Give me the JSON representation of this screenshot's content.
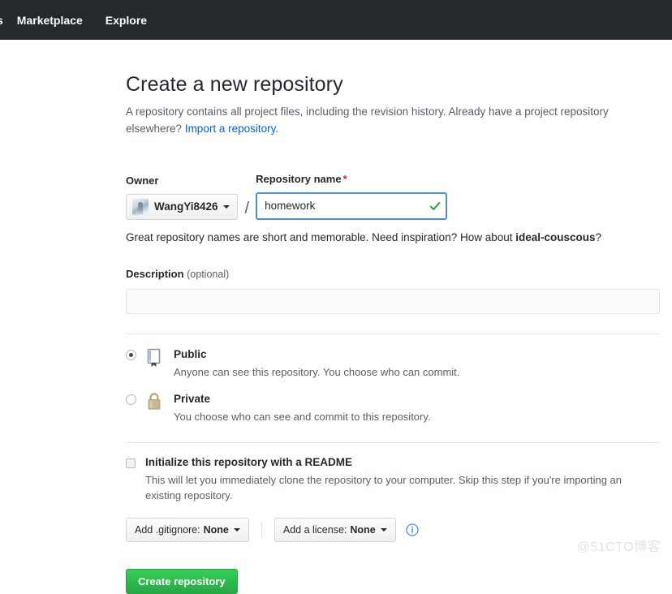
{
  "nav": {
    "partial_item": "s",
    "items": [
      {
        "label": "Marketplace"
      },
      {
        "label": "Explore"
      }
    ]
  },
  "page": {
    "title": "Create a new repository",
    "subtitle": "A repository contains all project files, including the revision history. Already have a project repository elsewhere?",
    "import_link": "Import a repository."
  },
  "owner": {
    "label": "Owner",
    "value": "WangYi8426",
    "separator": "/"
  },
  "repository_name": {
    "label": "Repository name",
    "required_marker": "*",
    "value": "homework",
    "valid": true,
    "hint_prefix": "Great repository names are short and memorable. Need inspiration? How about ",
    "hint_suggestion": "ideal-couscous",
    "hint_suffix": "?"
  },
  "description": {
    "label": "Description",
    "optional_label": "(optional)",
    "value": "",
    "placeholder": ""
  },
  "visibility": {
    "options": [
      {
        "title": "Public",
        "description": "Anyone can see this repository. You choose who can commit.",
        "selected": true,
        "icon": "repo-book-icon"
      },
      {
        "title": "Private",
        "description": "You choose who can see and commit to this repository.",
        "selected": false,
        "icon": "lock-icon"
      }
    ]
  },
  "readme": {
    "title": "Initialize this repository with a README",
    "description": "This will let you immediately clone the repository to your computer. Skip this step if you're importing an existing repository.",
    "checked": false
  },
  "extras": {
    "gitignore": {
      "prefix": "Add .gitignore:",
      "value": "None"
    },
    "license": {
      "prefix": "Add a license:",
      "value": "None"
    },
    "info_icon": "info-circle-icon"
  },
  "submit": {
    "label": "Create repository"
  },
  "watermark": {
    "text": "@51CTO博客"
  },
  "colors": {
    "nav_background": "#24292e",
    "accent_green": "#28a745",
    "link_blue": "#0366d6",
    "focus_blue": "#4a90d9",
    "required_red": "#cb2431",
    "lock_gold": "#b5a677"
  }
}
